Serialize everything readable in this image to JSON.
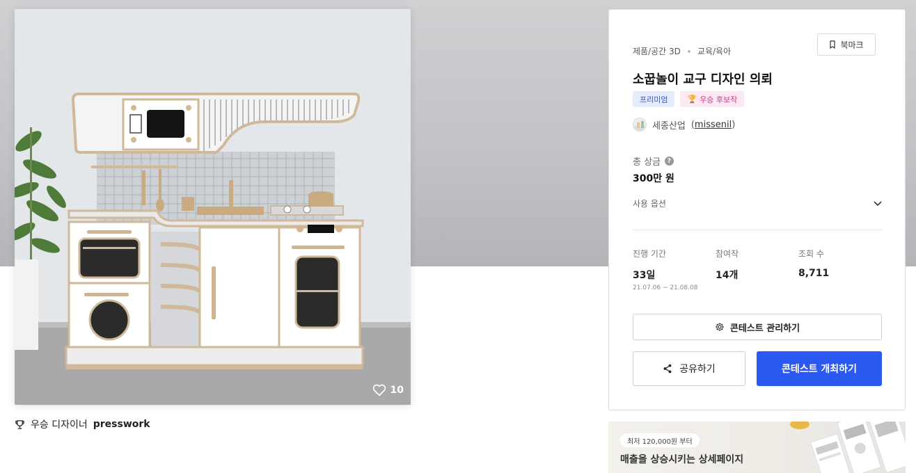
{
  "main_image": {
    "alt": "play kitchen toy design",
    "like_count": "10"
  },
  "winner": {
    "label": "우승 디자이너",
    "name": "presswork"
  },
  "card": {
    "categories": [
      "제품/공간 3D",
      "교육/육아"
    ],
    "bookmark_label": "북마크",
    "title": "소꿉놀이 교구 디자인 의뢰",
    "badges": {
      "premium": "프리미엄",
      "winner_candidate": "우승 후보작"
    },
    "host": {
      "company": "세종산업",
      "id_open": "(",
      "id": "missenil",
      "id_close": ")"
    },
    "prize": {
      "label": "총 상금",
      "help": "?",
      "value": "300만 원"
    },
    "options_label": "사용 옵션",
    "stats": {
      "period": {
        "label": "진행 기간",
        "value": "33일",
        "range": "21.07.06 ~ 21.08.08"
      },
      "entries": {
        "label": "참여작",
        "value": "14개"
      },
      "views": {
        "label": "조회 수",
        "value": "8,711"
      }
    },
    "manage_button": "콘테스트 관리하기",
    "share_button": "공유하기",
    "host_button": "콘테스트 개최하기"
  },
  "ad": {
    "pill": "최저 120,000원 부터",
    "headline": "매출을 상승시키는 상세페이지"
  },
  "colors": {
    "primary": "#2a58f0",
    "premium_badge_bg": "#e5ecff",
    "premium_badge_text": "#3056d3",
    "winner_badge_bg": "#fde9f4",
    "winner_badge_text": "#d3328f"
  },
  "icons": {
    "bookmark": "bookmark-icon",
    "trophy": "trophy-icon",
    "help": "help-icon",
    "chevron": "chevron-down-icon",
    "gear": "gear-icon",
    "share": "share-icon",
    "heart": "heart-icon"
  }
}
